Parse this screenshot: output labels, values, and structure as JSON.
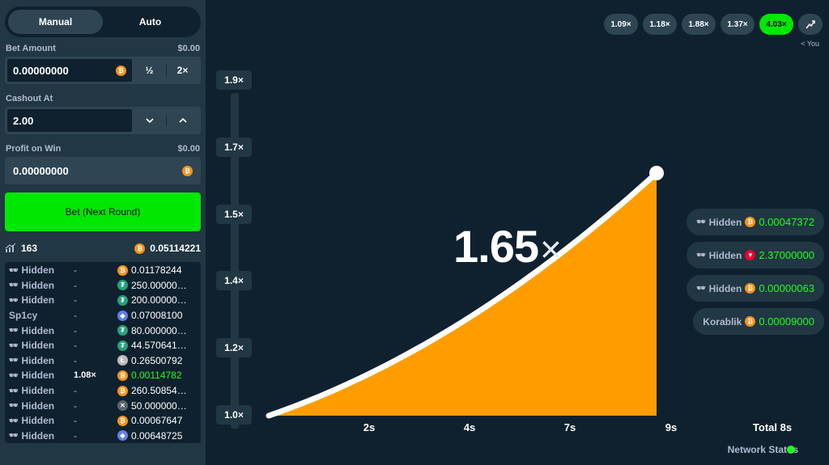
{
  "tabs": [
    {
      "label": "Manual"
    },
    {
      "label": "Auto"
    }
  ],
  "bet_amount": {
    "label": "Bet Amount",
    "usd": "$0.00",
    "value": "0.00000000",
    "half": "½",
    "double": "2×"
  },
  "cashout": {
    "label": "Cashout At",
    "value": "2.00"
  },
  "profit": {
    "label": "Profit on Win",
    "usd": "$0.00",
    "value": "0.00000000"
  },
  "bet_button": "Bet (Next Round)",
  "stats": {
    "players": "163",
    "total": "0.05114221"
  },
  "players": [
    {
      "name": "Hidden",
      "multiplier": "-",
      "amount": "0.01178244",
      "currency": "btc",
      "hidden": true
    },
    {
      "name": "Hidden",
      "multiplier": "-",
      "amount": "250.00000…",
      "currency": "usdt",
      "hidden": true
    },
    {
      "name": "Hidden",
      "multiplier": "-",
      "amount": "200.00000…",
      "currency": "usdt",
      "hidden": true
    },
    {
      "name": "Sp1cy",
      "multiplier": "-",
      "amount": "0.07008100",
      "currency": "eth",
      "hidden": false
    },
    {
      "name": "Hidden",
      "multiplier": "-",
      "amount": "80.000000…",
      "currency": "usdt",
      "hidden": true
    },
    {
      "name": "Hidden",
      "multiplier": "-",
      "amount": "44.570641…",
      "currency": "usdt",
      "hidden": true
    },
    {
      "name": "Hidden",
      "multiplier": "-",
      "amount": "0.26500792",
      "currency": "ltc",
      "hidden": true
    },
    {
      "name": "Hidden",
      "multiplier": "1.08×",
      "amount": "0.00114782",
      "currency": "btc",
      "hidden": true,
      "won": true
    },
    {
      "name": "Hidden",
      "multiplier": "-",
      "amount": "260.50854…",
      "currency": "btc",
      "hidden": true
    },
    {
      "name": "Hidden",
      "multiplier": "-",
      "amount": "50.000000…",
      "currency": "xrp",
      "hidden": true
    },
    {
      "name": "Hidden",
      "multiplier": "-",
      "amount": "0.00067647",
      "currency": "btc",
      "hidden": true
    },
    {
      "name": "Hidden",
      "multiplier": "-",
      "amount": "0.00648725",
      "currency": "eth",
      "hidden": true
    }
  ],
  "history": [
    {
      "value": "1.09×",
      "highlight": false
    },
    {
      "value": "1.18×",
      "highlight": false
    },
    {
      "value": "1.88×",
      "highlight": false
    },
    {
      "value": "1.37×",
      "highlight": false
    },
    {
      "value": "4.03×",
      "highlight": true
    }
  ],
  "history_you": "< You",
  "multiplier": {
    "value": "1.65",
    "suffix": "×"
  },
  "y_axis": [
    "1.9×",
    "1.7×",
    "1.5×",
    "1.4×",
    "1.2×",
    "1.0×"
  ],
  "x_axis": [
    "2s",
    "4s",
    "7s",
    "9s",
    "Total 8s"
  ],
  "cashouts": [
    {
      "name": "Hidden",
      "amount": "0.00047372",
      "currency": "btc",
      "hidden": true
    },
    {
      "name": "Hidden",
      "amount": "2.37000000",
      "currency": "trx",
      "hidden": true
    },
    {
      "name": "Hidden",
      "amount": "0.00000063",
      "currency": "btc",
      "hidden": true
    },
    {
      "name": "Korablik",
      "amount": "0.00009000",
      "currency": "btc",
      "hidden": false
    }
  ],
  "network_status": "Network Status",
  "colors": {
    "accent_green": "#00e701",
    "curve_fill": "#ff9d00",
    "panel": "#213743",
    "background": "#0f212e"
  }
}
